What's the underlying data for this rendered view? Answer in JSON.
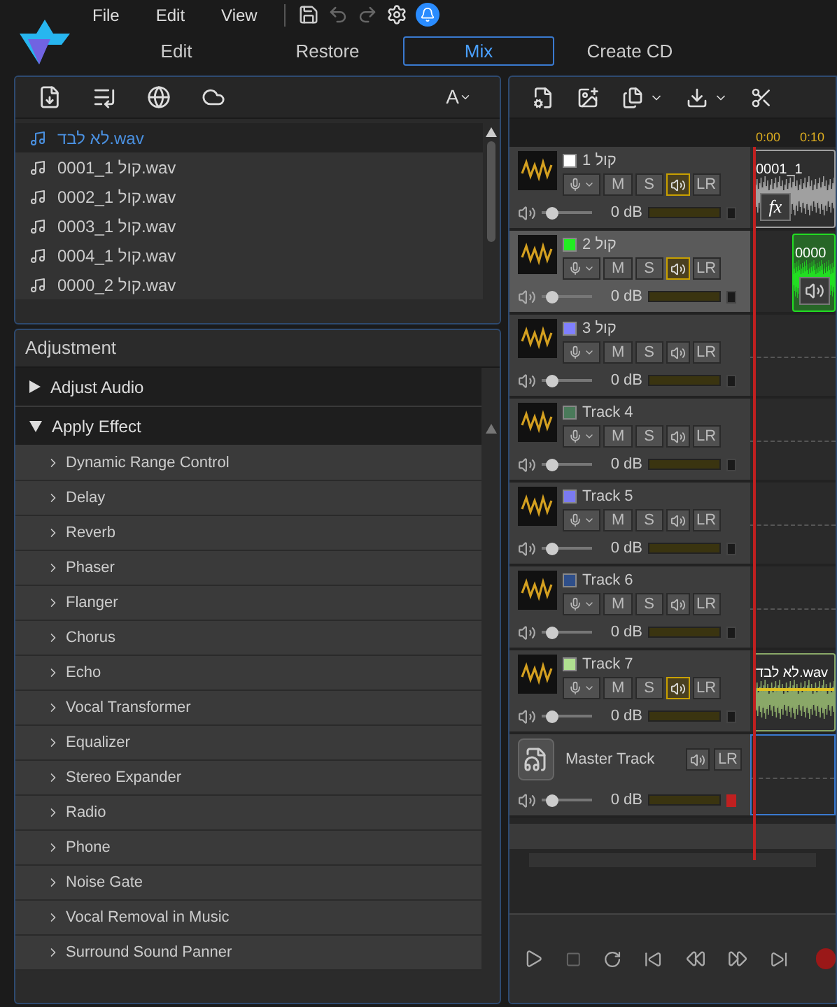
{
  "menu": [
    "File",
    "Edit",
    "View"
  ],
  "tabs": [
    {
      "label": "Edit",
      "selected": false
    },
    {
      "label": "Restore",
      "selected": false
    },
    {
      "label": "Mix",
      "selected": true
    },
    {
      "label": "Create CD",
      "selected": false
    }
  ],
  "font_button": "A",
  "files": [
    {
      "name": "לא לבד.wav",
      "selected": true
    },
    {
      "name": "0001_1 קול.wav",
      "selected": false
    },
    {
      "name": "0002_1 קול.wav",
      "selected": false
    },
    {
      "name": "0003_1 קול.wav",
      "selected": false
    },
    {
      "name": "0004_1 קול.wav",
      "selected": false
    },
    {
      "name": "0000_2 קול.wav",
      "selected": false
    }
  ],
  "adjustment": {
    "title": "Adjustment",
    "sections": [
      {
        "label": "Adjust Audio",
        "expanded": false
      },
      {
        "label": "Apply Effect",
        "expanded": true,
        "items": [
          "Dynamic Range Control",
          "Delay",
          "Reverb",
          "Phaser",
          "Flanger",
          "Chorus",
          "Echo",
          "Vocal Transformer",
          "Equalizer",
          "Stereo Expander",
          "Radio",
          "Phone",
          "Noise Gate",
          "Vocal Removal in Music",
          "Surround Sound Panner"
        ]
      }
    ]
  },
  "ruler": [
    "0:00",
    "0:10"
  ],
  "tracks": [
    {
      "kind": "track",
      "name": "1 קול",
      "color": "#ffffff",
      "selected": false,
      "output_on": true,
      "mute": "M",
      "solo": "S",
      "pan": "LR",
      "volume": "0 dB",
      "level": 0.2,
      "clipping": false,
      "clip": {
        "label": "0001_1",
        "color": "#a0a0a0",
        "kind": "fx",
        "fx": "fx"
      }
    },
    {
      "kind": "track",
      "name": "2 קול",
      "color": "#22ee22",
      "selected": true,
      "output_on": true,
      "mute": "M",
      "solo": "S",
      "pan": "LR",
      "volume": "0 dB",
      "level": 0.2,
      "clipping": false,
      "clip": {
        "label": "0000",
        "color": "#22dd22",
        "kind": "speaker"
      }
    },
    {
      "kind": "track",
      "name": "3 קול",
      "color": "#8080ff",
      "selected": false,
      "output_on": false,
      "mute": "M",
      "solo": "S",
      "pan": "LR",
      "volume": "0 dB",
      "level": 0.2,
      "clipping": false
    },
    {
      "kind": "track",
      "name": "Track 4",
      "color": "#4a7a5a",
      "selected": false,
      "output_on": false,
      "mute": "M",
      "solo": "S",
      "pan": "LR",
      "volume": "0 dB",
      "level": 0.2,
      "clipping": false
    },
    {
      "kind": "track",
      "name": "Track 5",
      "color": "#7a7af0",
      "selected": false,
      "output_on": false,
      "mute": "M",
      "solo": "S",
      "pan": "LR",
      "volume": "0 dB",
      "level": 0.2,
      "clipping": false
    },
    {
      "kind": "track",
      "name": "Track 6",
      "color": "#2f4f8a",
      "selected": false,
      "output_on": false,
      "mute": "M",
      "solo": "S",
      "pan": "LR",
      "volume": "0 dB",
      "level": 0.2,
      "clipping": false
    },
    {
      "kind": "track",
      "name": "Track 7",
      "color": "#b0e090",
      "selected": false,
      "output_on": true,
      "mute": "M",
      "solo": "S",
      "pan": "LR",
      "volume": "0 dB",
      "level": 0.2,
      "clipping": false,
      "clip": {
        "label": "לא לבד.wav",
        "color": "#8aa868",
        "kind": "envelope"
      }
    },
    {
      "kind": "master",
      "name": "Master Track",
      "selected": false,
      "output_on": false,
      "pan": "LR",
      "volume": "0 dB",
      "level": 0.2,
      "clipping": true
    }
  ]
}
